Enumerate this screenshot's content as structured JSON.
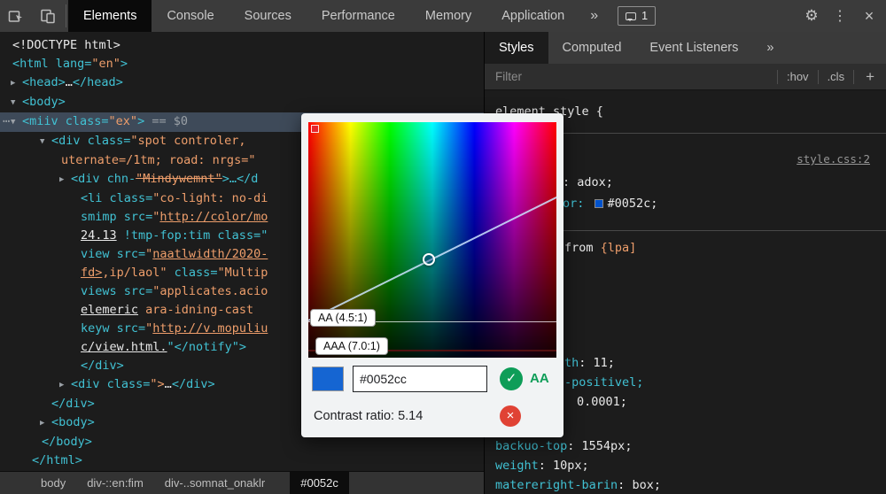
{
  "colors": {
    "accent_blue": "#0052cc",
    "swatch_blue": "#1565d2",
    "check_green": "#0e9d58",
    "cross_red": "#e04234"
  },
  "icons": {
    "gear": "⚙",
    "dots": "⋮",
    "close": "×",
    "check": "✓",
    "cross": "×",
    "overflow": "»"
  },
  "topbar": {
    "tabs": [
      {
        "label": "Elements",
        "active": true
      },
      {
        "label": "Console"
      },
      {
        "label": "Sources"
      },
      {
        "label": "Performance"
      },
      {
        "label": "Memory"
      },
      {
        "label": "Application"
      }
    ],
    "badge_count": "1"
  },
  "dom_tree": {
    "lines": [
      {
        "indent": 0,
        "segments": [
          {
            "t": "<!DOCTYPE html>",
            "c": "plain"
          }
        ]
      },
      {
        "indent": 0,
        "segments": [
          {
            "t": "<html lang=",
            "c": "tag"
          },
          {
            "t": "\"en\"",
            "c": "value"
          },
          {
            "t": ">",
            "c": "tag"
          }
        ]
      },
      {
        "indent": 1,
        "arrow": "right",
        "segments": [
          {
            "t": "<head>",
            "c": "tag"
          },
          {
            "t": "…",
            "c": "plain"
          },
          {
            "t": "</head>",
            "c": "tag"
          }
        ]
      },
      {
        "indent": 1,
        "arrow": "down",
        "segments": [
          {
            "t": "<body>",
            "c": "tag"
          }
        ]
      },
      {
        "indent": 1,
        "arrow": "down",
        "sel": true,
        "gutter": "⋯",
        "segments": [
          {
            "t": "<miiv class=",
            "c": "tag"
          },
          {
            "t": "\"ex\"",
            "c": "value"
          },
          {
            "t": ">",
            "c": "tag"
          },
          {
            "t": " == ",
            "c": "dim"
          },
          {
            "t": "$0",
            "c": "dim"
          }
        ]
      },
      {
        "indent": 4,
        "arrow": "down",
        "segments": [
          {
            "t": "<div class=",
            "c": "tag"
          },
          {
            "t": "\"spot controler,",
            "c": "value"
          }
        ]
      },
      {
        "indent": 5,
        "segments": [
          {
            "t": "uternate=/1tm; road: nrgs=\"",
            "c": "value"
          }
        ]
      },
      {
        "indent": 6,
        "arrow": "right",
        "segments": [
          {
            "t": "<div chn-",
            "c": "tag"
          },
          {
            "t": "\"Mindywemnt\"",
            "c": "value strike"
          },
          {
            "t": ">…</d",
            "c": "tag"
          }
        ]
      },
      {
        "indent": 7,
        "segments": [
          {
            "t": "<li class=",
            "c": "tag"
          },
          {
            "t": "\"co-light: no-di",
            "c": "value"
          }
        ]
      },
      {
        "indent": 7,
        "segments": [
          {
            "t": "smimp src=",
            "c": "tag"
          },
          {
            "t": "\"",
            "c": "value"
          },
          {
            "t": "http://color/mo",
            "c": "value link"
          }
        ]
      },
      {
        "indent": 7,
        "segments": [
          {
            "t": "24.13",
            "c": "plain link"
          },
          {
            "t": " !tmp-fop:tim class=\"",
            "c": "tag"
          }
        ]
      },
      {
        "indent": 7,
        "segments": [
          {
            "t": "view src=",
            "c": "tag"
          },
          {
            "t": "\"",
            "c": "value"
          },
          {
            "t": "naatlwidth/2020-",
            "c": "value link"
          }
        ]
      },
      {
        "indent": 7,
        "segments": [
          {
            "t": "fd>",
            "c": "value link"
          },
          {
            "t": ",ip/laol\"",
            "c": "value"
          },
          {
            "t": " class=",
            "c": "tag"
          },
          {
            "t": "\"Multip",
            "c": "value"
          }
        ]
      },
      {
        "indent": 7,
        "segments": [
          {
            "t": "views src=",
            "c": "tag"
          },
          {
            "t": "\"applicates.acio",
            "c": "value"
          }
        ]
      },
      {
        "indent": 7,
        "segments": [
          {
            "t": "elemeric",
            "c": "plain link"
          },
          {
            "t": " ara-idning-cast",
            "c": "value"
          }
        ]
      },
      {
        "indent": 7,
        "segments": [
          {
            "t": "keyw src=",
            "c": "tag"
          },
          {
            "t": "\"",
            "c": "value"
          },
          {
            "t": "http://v.mopuliu",
            "c": "value link"
          }
        ]
      },
      {
        "indent": 7,
        "segments": [
          {
            "t": "c/view.html.",
            "c": "plain link"
          },
          {
            "t": "\"</notify\">",
            "c": "tag"
          }
        ]
      },
      {
        "indent": 7,
        "segments": [
          {
            "t": "</div>",
            "c": "tag"
          }
        ]
      },
      {
        "indent": 6,
        "arrow": "right",
        "segments": [
          {
            "t": "<div class=",
            "c": "tag"
          },
          {
            "t": "\">",
            "c": "value"
          },
          {
            "t": "…",
            "c": "plain"
          },
          {
            "t": "</div>",
            "c": "tag"
          }
        ]
      },
      {
        "indent": 4,
        "segments": [
          {
            "t": "</div>",
            "c": "tag"
          }
        ]
      },
      {
        "indent": 4,
        "arrow": "right",
        "segments": [
          {
            "t": "<body>",
            "c": "tag"
          }
        ]
      },
      {
        "indent": 3,
        "segments": [
          {
            "t": "</body>",
            "c": "tag"
          }
        ]
      },
      {
        "indent": 2,
        "segments": [
          {
            "t": "</html>",
            "c": "tag"
          }
        ]
      }
    ]
  },
  "breadcrumbs": {
    "items": [
      {
        "label": "body"
      },
      {
        "label": "div-::en:fim"
      },
      {
        "label": "div-..somnat_onaklr"
      },
      {
        "label": "#0052c",
        "active": true
      }
    ]
  },
  "styles_pane": {
    "tabs": [
      {
        "label": "Styles",
        "active": true
      },
      {
        "label": "Computed"
      },
      {
        "label": "Event Listeners"
      }
    ],
    "filter_placeholder": "Filter",
    "toggle_hov": ":hov",
    "toggle_cls": ".cls",
    "toggle_add": "+",
    "rule_link": "style.css:2",
    "lines": {
      "element_style": [
        {
          "t": "element.style {",
          "c": "plain"
        }
      ],
      "adox": [
        {
          "t": ": adox;",
          "c": "plain"
        }
      ],
      "color": [
        {
          "t": "or: ",
          "c": "prop"
        },
        {
          "c": "swatch"
        },
        {
          "t": "#0052c;",
          "c": "plain"
        }
      ],
      "from": [
        {
          "t": "from ",
          "c": "plain"
        },
        {
          "t": "{lpa]",
          "c": "value"
        }
      ],
      "brace": [
        {
          "t": "{",
          "c": "plain"
        }
      ],
      "l1": [
        {
          "t": "th",
          "c": "prop"
        },
        {
          "t": ": 11;",
          "c": "plain"
        }
      ],
      "l2": [
        {
          "t": "-positivel;",
          "c": "prop"
        }
      ],
      "l3": [
        {
          "t": "0.0001;",
          "c": "plain"
        }
      ],
      "l4": [
        {
          "t": "backuo-top",
          "c": "prop"
        },
        {
          "t": ": ",
          "c": "plain"
        },
        {
          "t": "1554px;",
          "c": "plain"
        }
      ],
      "l5": [
        {
          "t": "weight",
          "c": "prop"
        },
        {
          "t": ": ",
          "c": "plain"
        },
        {
          "t": "10px;",
          "c": "plain"
        }
      ],
      "l6": [
        {
          "t": "matereright-barin",
          "c": "prop"
        },
        {
          "t": ": ",
          "c": "plain"
        },
        {
          "t": "box;",
          "c": "plain"
        }
      ]
    }
  },
  "picker": {
    "hex": "#0052cc",
    "aa_pill": "AA (4.5:1)",
    "aaa_pill": "AAA (7.0:1)",
    "pass_label": "AA",
    "contrast_text": "Contrast ratio: 5.14"
  }
}
